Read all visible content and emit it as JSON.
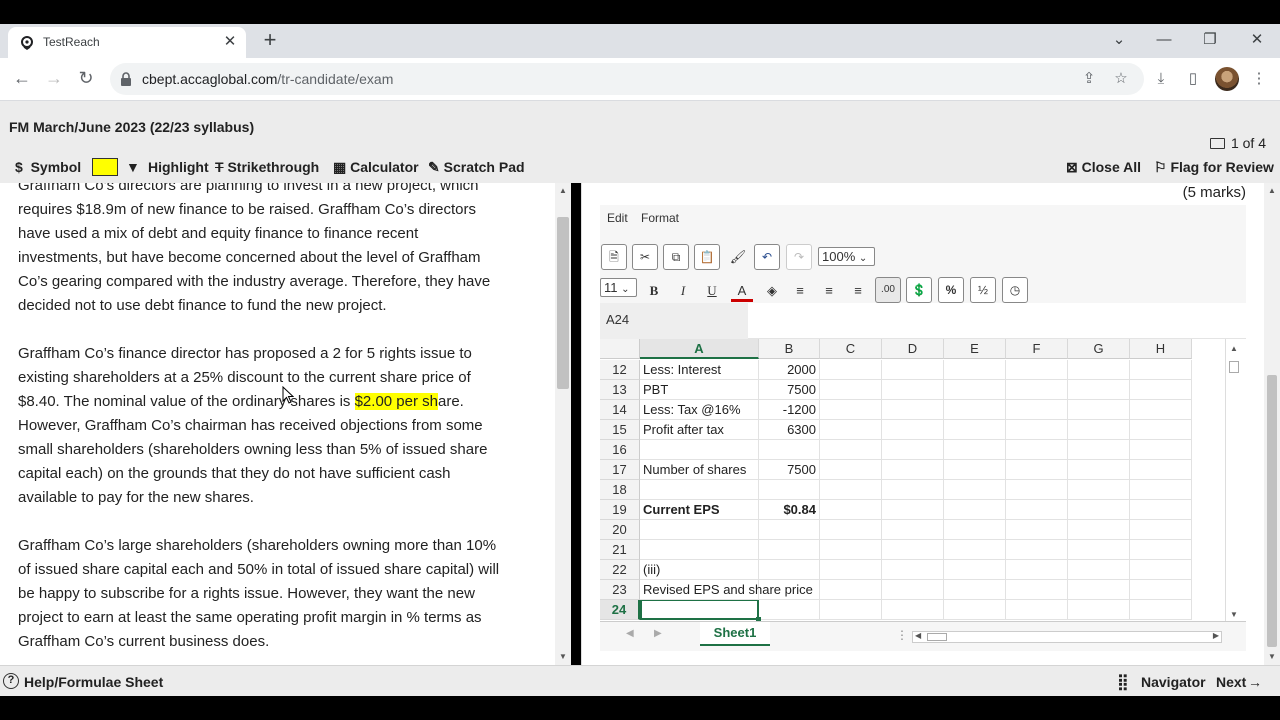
{
  "browser": {
    "tab_title": "TestReach",
    "tab_close": "✕",
    "new_tab": "+",
    "url_host": "cbept.accaglobal.com",
    "url_path": "/tr-candidate/exam"
  },
  "exam": {
    "title": "FM March/June 2023 (22/23 syllabus)",
    "page_indicator": "1 of 4",
    "tools": {
      "symbol": "Symbol",
      "highlight": "Highlight",
      "strikethrough": "Strikethrough",
      "calculator": "Calculator",
      "scratch_pad": "Scratch Pad",
      "close_all": "Close All",
      "flag": "Flag for Review"
    },
    "highlight_color": "#ffff00",
    "marks": "(5 marks)"
  },
  "passage": {
    "p1_lines": [
      "Graffham Co’s directors are planning to invest in a new project, which",
      "requires $18.9m of new finance to be raised. Graffham Co’s directors",
      "have used a mix of debt and equity finance to finance recent",
      "investments, but have become concerned about the level of Graffham",
      "Co’s gearing compared with the industry average. Therefore, they have",
      "decided not to use debt finance to fund the new project."
    ],
    "p2_line1": "Graffham Co’s finance director has proposed a 2 for 5 rights issue to",
    "p2_line2": "existing shareholders at a 25% discount to the current share price of",
    "p2_line3_pre": "$8.40. The nominal value of the ordinary shares is ",
    "p2_line3_hl": "$2.00 per sh",
    "p2_line3_post": "are.",
    "p2_rest": [
      "However, Graffham Co’s chairman has received objections from some",
      "small shareholders (shareholders owning less than 5% of issued share",
      "capital each) on the grounds that they do not have sufficient cash",
      "available to pay for the new shares."
    ],
    "p3_lines": [
      "Graffham Co’s large shareholders (shareholders owning more than 10%",
      "of issued share capital each and 50% in total of issued share capital) will",
      "be happy to subscribe for a rights issue. However, they want the new",
      "project to earn at least the same operating profit margin in % terms as",
      "Graffham Co’s current business does."
    ]
  },
  "spreadsheet": {
    "menu_edit": "Edit",
    "menu_format": "Format",
    "zoom": "100%",
    "font_size": "11",
    "decimal_btn": ".00",
    "percent_btn": "%",
    "fraction_btn": "½",
    "name_box": "A24",
    "columns": [
      "A",
      "B",
      "C",
      "D",
      "E",
      "F",
      "G",
      "H"
    ],
    "rows": [
      {
        "n": "12",
        "a": "Less: Interest",
        "b": "2000"
      },
      {
        "n": "13",
        "a": "PBT",
        "b": "7500"
      },
      {
        "n": "14",
        "a": "Less: Tax @16%",
        "b": "-1200"
      },
      {
        "n": "15",
        "a": "Profit after tax",
        "b": "6300"
      },
      {
        "n": "16",
        "a": "",
        "b": ""
      },
      {
        "n": "17",
        "a": "Number of shares",
        "b": "7500"
      },
      {
        "n": "18",
        "a": "",
        "b": ""
      },
      {
        "n": "19",
        "a": "Current EPS",
        "b": "$0.84"
      },
      {
        "n": "20",
        "a": "",
        "b": ""
      },
      {
        "n": "21",
        "a": "",
        "b": ""
      },
      {
        "n": "22",
        "a": "(iii)",
        "b": ""
      },
      {
        "n": "23",
        "a": "Revised EPS and share price",
        "b": ""
      },
      {
        "n": "24",
        "a": "",
        "b": ""
      }
    ],
    "sheet_tab": "Sheet1"
  },
  "footer": {
    "help": "Help/Formulae Sheet",
    "navigator": "Navigator",
    "next": "Next"
  }
}
